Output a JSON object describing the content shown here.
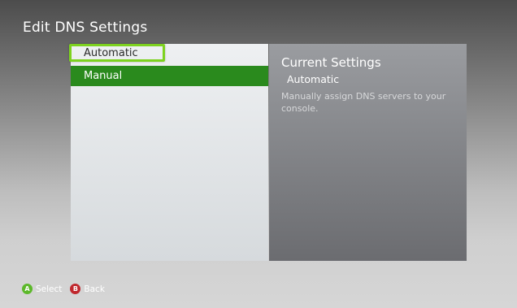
{
  "page": {
    "title": "Edit DNS Settings"
  },
  "menu": {
    "items": [
      {
        "label": "Automatic",
        "focused": true
      },
      {
        "label": "Manual",
        "selected": true
      }
    ]
  },
  "info": {
    "title": "Current Settings",
    "value": "Automatic",
    "description": "Manually assign DNS servers to your console."
  },
  "footer": {
    "a_glyph": "A",
    "select_label": "Select",
    "b_glyph": "B",
    "back_label": "Back"
  },
  "colors": {
    "focus_ring": "#7dd21f",
    "selected_bg": "#2a8a1d",
    "a_button": "#5cb82a",
    "b_button": "#c0272d"
  }
}
